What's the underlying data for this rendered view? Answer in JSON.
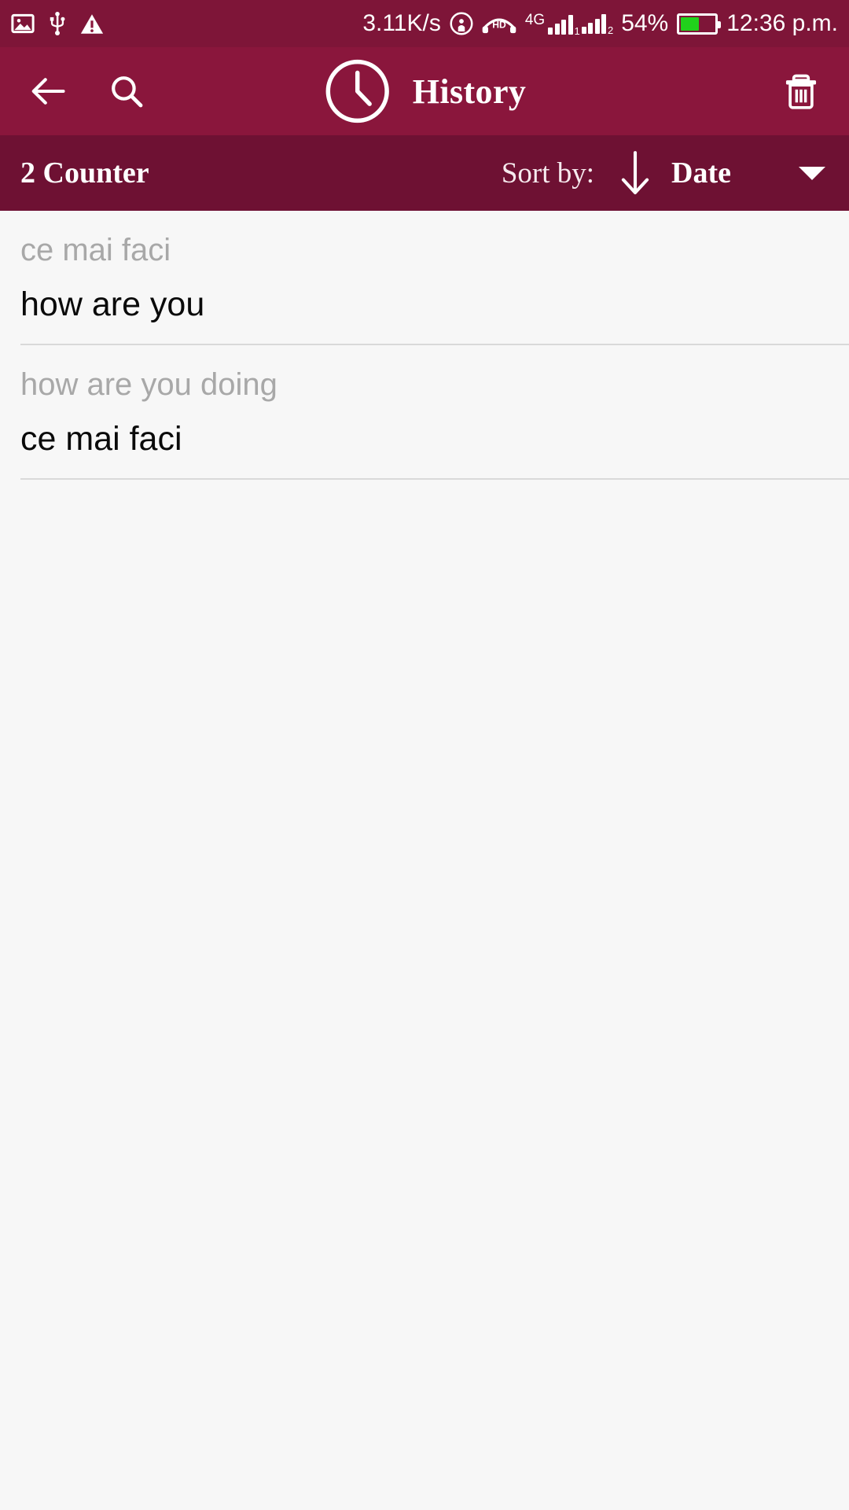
{
  "statusbar": {
    "icons_left": [
      "gallery-icon",
      "usb-icon",
      "warning-icon"
    ],
    "network_speed": "3.11K/s",
    "hotspot_icon": "hotspot-icon",
    "hd_label": "HD",
    "network_type": "4G",
    "sim1_label": "1",
    "sim2_label": "2",
    "battery_percent": "54%",
    "battery_level": 54,
    "battery_color": "#21d21b",
    "time": "12:36 p.m."
  },
  "appbar": {
    "back_label": "back-arrow",
    "search_label": "search",
    "clock_label": "clock",
    "title": "History",
    "delete_label": "delete",
    "background": "#8a163c"
  },
  "sortbar": {
    "counter": "2 Counter",
    "sort_by_label": "Sort by:",
    "sort_direction": "descending",
    "sort_value": "Date",
    "background": "#6e1133"
  },
  "list": {
    "entries": [
      {
        "source": "ce mai faci",
        "translation": "how are you"
      },
      {
        "source": "how are you doing",
        "translation": "ce mai faci"
      }
    ]
  },
  "colors": {
    "primary": "#8a163c",
    "primary_dark": "#6e1133",
    "status_bar": "#7e1538",
    "list_background": "#f7f7f7",
    "source_text": "#a8a8a8",
    "translation_text": "#0a0a0a",
    "divider": "#d9d9d9"
  }
}
